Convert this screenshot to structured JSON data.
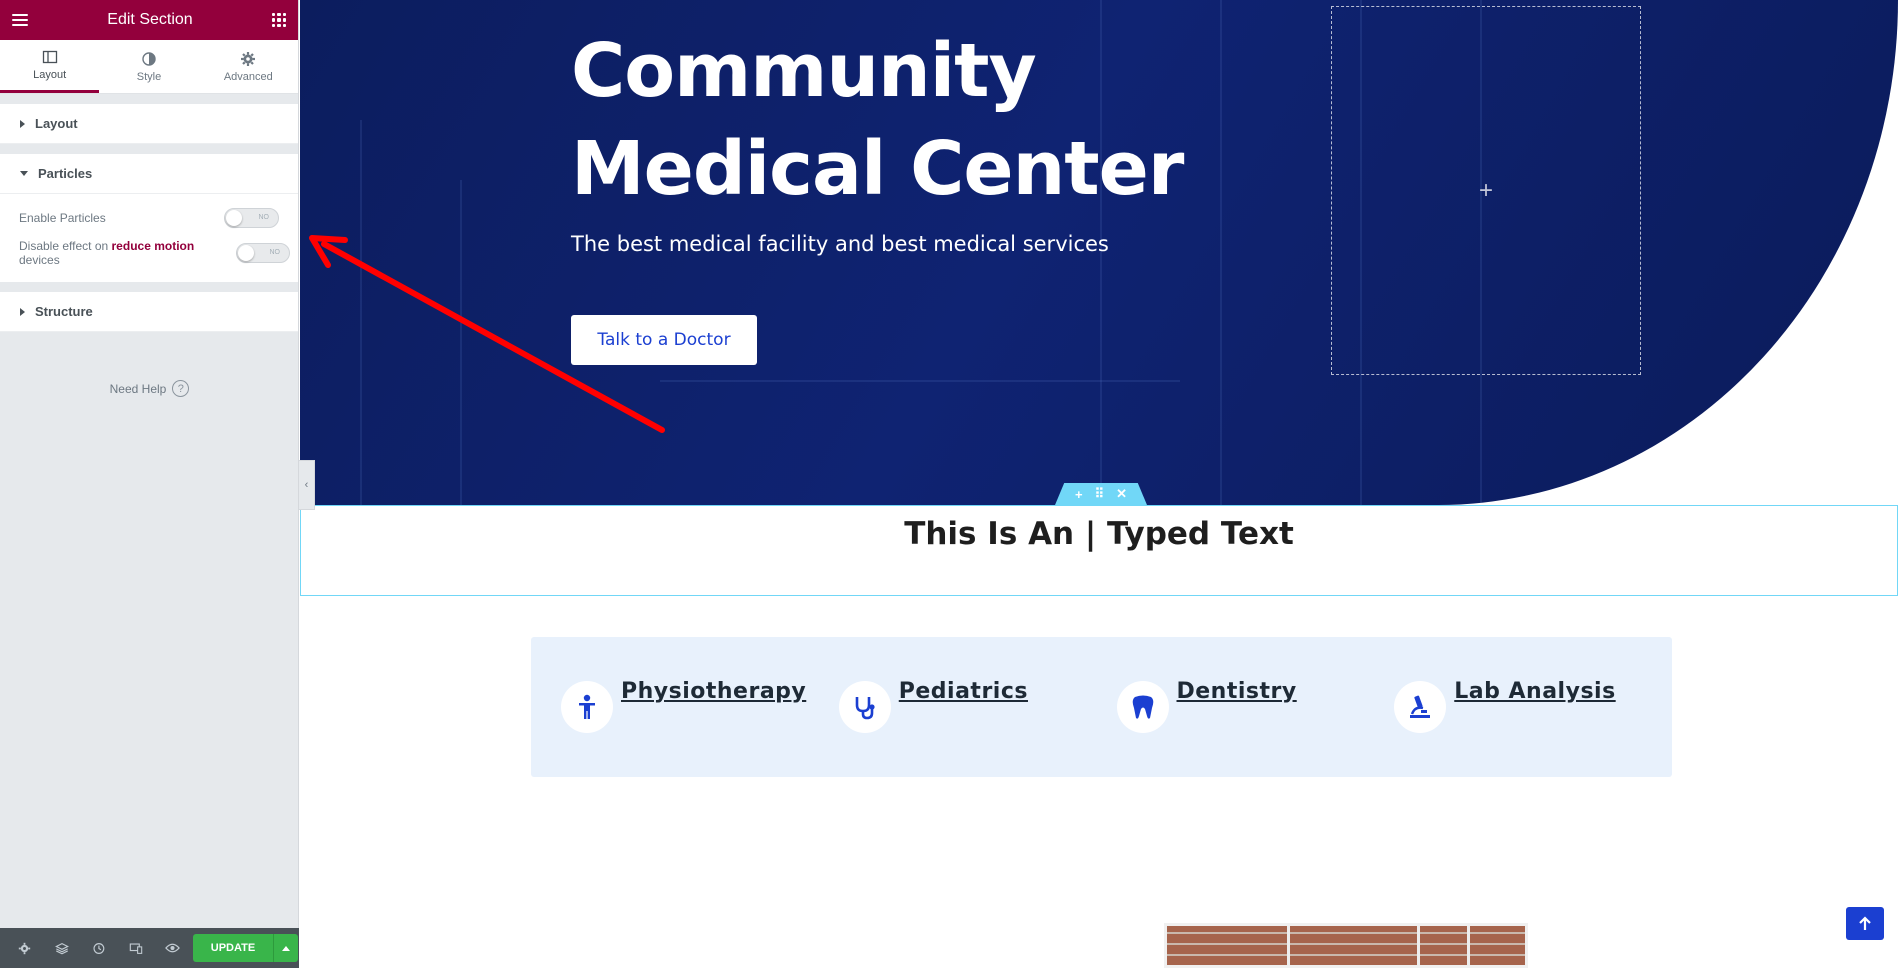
{
  "sidebar": {
    "header_title": "Edit Section",
    "tabs": [
      {
        "label": "Layout"
      },
      {
        "label": "Style"
      },
      {
        "label": "Advanced"
      }
    ],
    "sections": {
      "layout": "Layout",
      "particles": "Particles",
      "structure": "Structure"
    },
    "controls": {
      "enable_particles_label": "Enable Particles",
      "enable_particles_value": "NO",
      "disable_effect_prefix": "Disable effect on ",
      "disable_effect_accent": "reduce motion",
      "disable_effect_suffix": " devices",
      "disable_effect_value": "NO"
    },
    "need_help": "Need Help",
    "need_help_icon": "?",
    "footer": {
      "update_label": "UPDATE",
      "icons": [
        "settings-icon",
        "navigator-icon",
        "history-icon",
        "responsive-icon",
        "preview-icon"
      ]
    },
    "colors": {
      "brand": "#93003c",
      "update": "#39b54a"
    }
  },
  "hero": {
    "title_line1": "Community",
    "title_line2": "Medical Center",
    "subtitle": "The best medical facility and best medical services",
    "cta_label": "Talk to a Doctor",
    "placeholder_plus": "+"
  },
  "section_handle": {
    "add": "+",
    "move": "⠿",
    "remove": "✕"
  },
  "typed_text": "This Is An | Typed Text",
  "services": [
    {
      "label": "Physiotherapy",
      "icon": "person-icon"
    },
    {
      "label": "Pediatrics",
      "icon": "stethoscope-icon"
    },
    {
      "label": "Dentistry",
      "icon": "tooth-icon"
    },
    {
      "label": "Lab Analysis",
      "icon": "microscope-icon"
    }
  ],
  "colors": {
    "hero_bg": "#0f2372",
    "accent_blue": "#1b3fd1",
    "services_bg": "#e8f1fc",
    "section_outline": "#71d7f7",
    "annotation_arrow": "#ff0000"
  }
}
